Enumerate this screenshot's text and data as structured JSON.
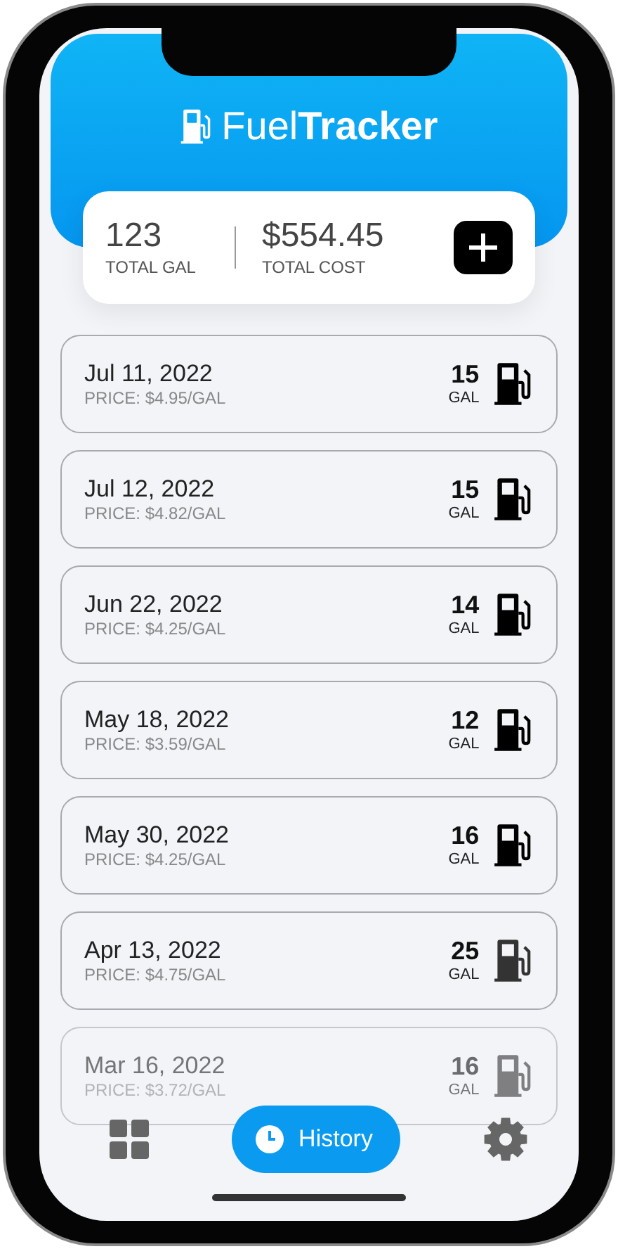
{
  "app": {
    "title_light": "Fuel",
    "title_bold": "Tracker"
  },
  "summary": {
    "total_gallons": "123",
    "total_gallons_label": "TOTAL GAL",
    "total_cost": "$554.45",
    "total_cost_label": "TOTAL COST"
  },
  "entries": [
    {
      "date": "Jul 11, 2022",
      "price": "PRICE: $4.95/GAL",
      "gallons": "15",
      "unit": "GAL",
      "faded": false
    },
    {
      "date": "Jul 12, 2022",
      "price": "PRICE: $4.82/GAL",
      "gallons": "15",
      "unit": "GAL",
      "faded": false
    },
    {
      "date": "Jun 22, 2022",
      "price": "PRICE: $4.25/GAL",
      "gallons": "14",
      "unit": "GAL",
      "faded": false
    },
    {
      "date": "May 18, 2022",
      "price": "PRICE: $3.59/GAL",
      "gallons": "12",
      "unit": "GAL",
      "faded": false
    },
    {
      "date": "May 30, 2022",
      "price": "PRICE: $4.25/GAL",
      "gallons": "16",
      "unit": "GAL",
      "faded": false
    },
    {
      "date": "Apr 13, 2022",
      "price": "PRICE: $4.75/GAL",
      "gallons": "25",
      "unit": "GAL",
      "faded": false
    },
    {
      "date": "Mar 16, 2022",
      "price": "PRICE: $3.72/GAL",
      "gallons": "16",
      "unit": "GAL",
      "faded": true
    }
  ],
  "tab_bar": [
    {
      "selected": false
    },
    {
      "label": "History",
      "selected": true
    },
    {
      "selected": false
    }
  ]
}
